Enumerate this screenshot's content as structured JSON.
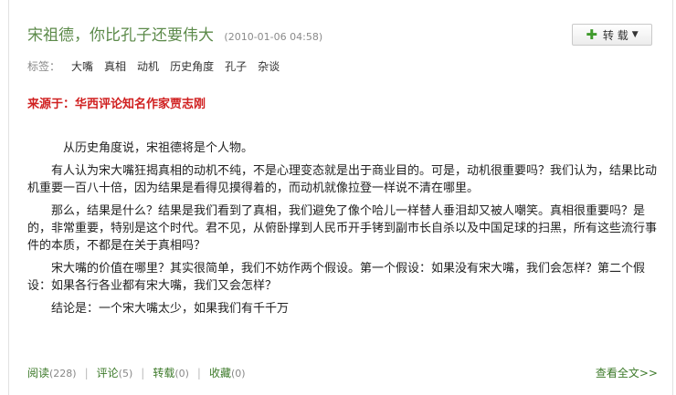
{
  "post": {
    "title": "宋祖德，你比孔子还要伟大",
    "date": "(2010-01-06 04:58)",
    "repost_label": "转 载",
    "tags_label": "标签：",
    "tags": [
      "大嘴",
      "真相",
      "动机",
      "历史角度",
      "孔子",
      "杂谈"
    ],
    "source": "来源于：华西评论知名作家贾志刚",
    "paragraphs": [
      "从历史角度说，宋祖德将是个人物。",
      "有人认为宋大嘴狂揭真相的动机不纯，不是心理变态就是出于商业目的。可是，动机很重要吗？我们认为，结果比动机重要一百八十倍，因为结果是看得见摸得着的，而动机就像拉登一样说不清在哪里。",
      "那么，结果是什么？结果是我们看到了真相，我们避免了像个哈儿一样替人垂泪却又被人嘲笑。真相很重要吗？是的，非常重要，特别是这个时代。君不见，从俯卧撑到人民币开手铐到副市长自杀以及中国足球的扫黑，所有这些流行事件的本质，不都是在关于真相吗？",
      "宋大嘴的价值在哪里？其实很简单，我们不妨作两个假设。第一个假设：如果没有宋大嘴，我们会怎样？第二个假设：如果各行各业都有宋大嘴，我们又会怎样？",
      "结论是：一个宋大嘴太少，如果我们有千千万"
    ]
  },
  "footer": {
    "read_label": "阅读",
    "read_count": "(228)",
    "comment_label": "评论",
    "comment_count": "(5)",
    "repost_label": "转载",
    "repost_count": "(0)",
    "favorite_label": "收藏",
    "favorite_count": "(0)",
    "separator": "|",
    "read_all": "查看全文>>"
  },
  "colors": {
    "title": "#5c8a4a",
    "source": "#d02020",
    "link": "#3d7a2a",
    "plus": "#3f9a2c"
  }
}
